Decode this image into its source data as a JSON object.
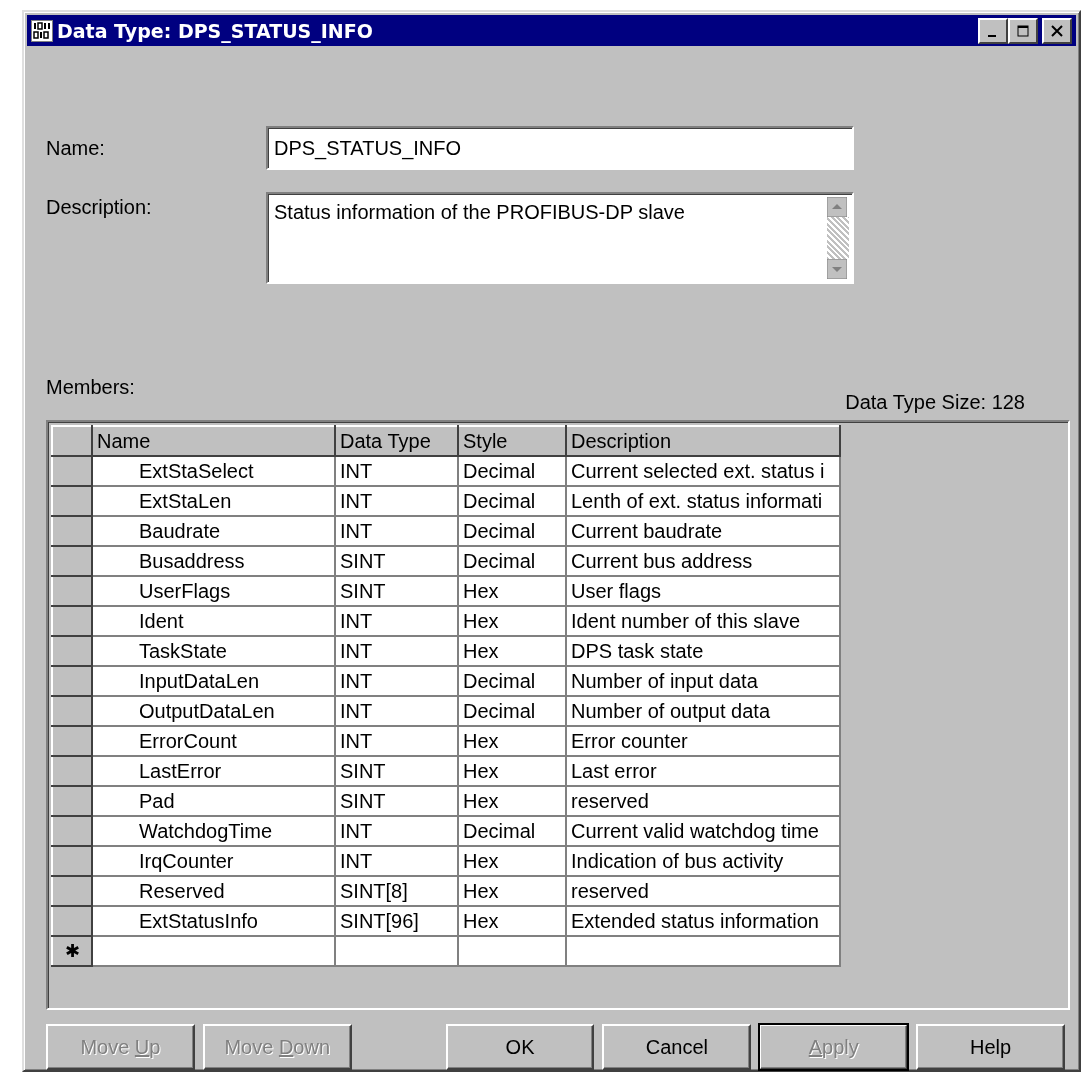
{
  "window": {
    "title": "Data Type:  DPS_STATUS_INFO"
  },
  "name_field": {
    "label": "Name:",
    "value": "DPS_STATUS_INFO"
  },
  "description_field": {
    "label": "Description:",
    "value": "Status information of the PROFIBUS-DP slave"
  },
  "members": {
    "label": "Members:",
    "size_label": "Data Type Size: 128",
    "columns": [
      "Name",
      "Data Type",
      "Style",
      "Description"
    ],
    "rows": [
      {
        "name": "ExtStaSelect",
        "data_type": "INT",
        "style": "Decimal",
        "description": "Current selected ext. status i"
      },
      {
        "name": "ExtStaLen",
        "data_type": "INT",
        "style": "Decimal",
        "description": "Lenth of ext. status informati"
      },
      {
        "name": "Baudrate",
        "data_type": "INT",
        "style": "Decimal",
        "description": "Current baudrate"
      },
      {
        "name": "Busaddress",
        "data_type": "SINT",
        "style": "Decimal",
        "description": "Current bus address"
      },
      {
        "name": "UserFlags",
        "data_type": "SINT",
        "style": "Hex",
        "description": "User flags"
      },
      {
        "name": "Ident",
        "data_type": "INT",
        "style": "Hex",
        "description": "Ident number of this slave"
      },
      {
        "name": "TaskState",
        "data_type": "INT",
        "style": "Hex",
        "description": "DPS task state"
      },
      {
        "name": "InputDataLen",
        "data_type": "INT",
        "style": "Decimal",
        "description": "Number of input data"
      },
      {
        "name": "OutputDataLen",
        "data_type": "INT",
        "style": "Decimal",
        "description": "Number of output data"
      },
      {
        "name": "ErrorCount",
        "data_type": "INT",
        "style": "Hex",
        "description": "Error counter"
      },
      {
        "name": "LastError",
        "data_type": "SINT",
        "style": "Hex",
        "description": "Last error"
      },
      {
        "name": "Pad",
        "data_type": "SINT",
        "style": "Hex",
        "description": "reserved"
      },
      {
        "name": "WatchdogTime",
        "data_type": "INT",
        "style": "Decimal",
        "description": "Current valid watchdog time"
      },
      {
        "name": "IrqCounter",
        "data_type": "INT",
        "style": "Hex",
        "description": "Indication of bus activity"
      },
      {
        "name": "Reserved",
        "data_type": "SINT[8]",
        "style": "Hex",
        "description": "reserved"
      },
      {
        "name": "ExtStatusInfo",
        "data_type": "SINT[96]",
        "style": "Hex",
        "description": "Extended status information"
      }
    ],
    "new_row_marker": "✱"
  },
  "buttons": [
    {
      "label_before": "Move ",
      "mnemonic": "U",
      "label_after": "p",
      "disabled": true,
      "default": false
    },
    {
      "label_before": "Move ",
      "mnemonic": "D",
      "label_after": "own",
      "disabled": true,
      "default": false
    },
    {
      "label": "OK",
      "disabled": false,
      "default": false
    },
    {
      "label": "Cancel",
      "disabled": false,
      "default": false
    },
    {
      "mnemonic": "A",
      "label_after": "pply",
      "disabled": true,
      "default": true
    },
    {
      "label": "Help",
      "disabled": false,
      "default": false
    }
  ]
}
